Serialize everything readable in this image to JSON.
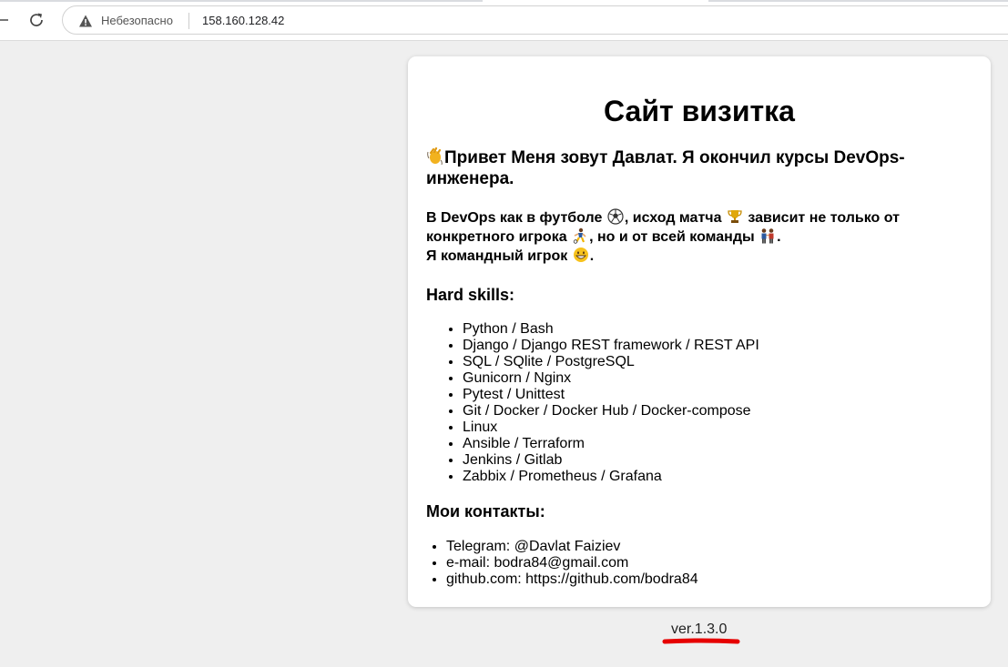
{
  "browser": {
    "security_label": "Небезопасно",
    "url": "158.160.128.42"
  },
  "card": {
    "title": "Сайт визитка",
    "intro": "Привет Меня зовут Давлат. Я окончил курсы DevOps-инженера.",
    "analogy": {
      "part1": "В DevOps как в футболе",
      "part2": ", исход матча",
      "part3": " зависит не только от конкретного игрока",
      "part4": ", но и от всей команды",
      "part5": ".",
      "part6": "Я командный игрок",
      "part7": "."
    },
    "skills_heading": "Hard skills:",
    "skills": [
      "Python / Bash",
      "Django / Django REST framework / REST API",
      "SQL / SQlite / PostgreSQL",
      "Gunicorn / Nginx",
      "Pytest / Unittest",
      "Git / Docker / Docker Hub / Docker-compose",
      "Linux",
      "Ansible / Terraform",
      "Jenkins / Gitlab",
      "Zabbix / Prometheus / Grafana"
    ],
    "contacts_heading": "Мои контакты:",
    "contacts": [
      "Telegram: @Davlat Faiziev",
      "e-mail: bodra84@gmail.com",
      "github.com: https://github.com/bodra84"
    ]
  },
  "footer": {
    "version": "ver.1.3.0"
  },
  "icons": {
    "wave": "waving-hand-icon",
    "ball": "soccer-ball-icon",
    "trophy": "trophy-icon",
    "player": "player-icon",
    "team": "team-icon",
    "smile": "grinning-face-icon"
  },
  "colors": {
    "highlight_underline": "#e60000"
  }
}
